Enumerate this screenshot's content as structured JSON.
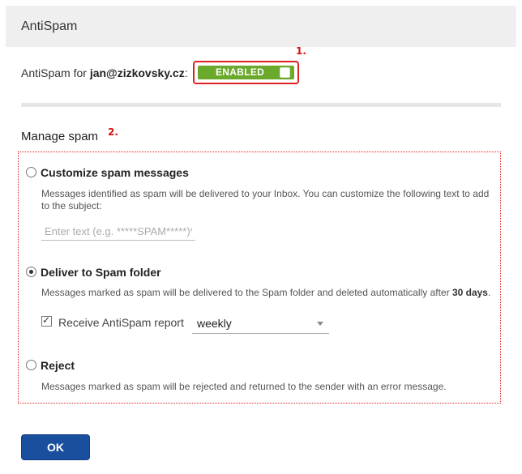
{
  "header": {
    "title": "AntiSpam"
  },
  "status": {
    "prefix": "AntiSpam for",
    "email": "jan@zizkovsky.cz",
    "suffix": ":",
    "toggle_label": "ENABLED",
    "toggle_color": "#6aa92b"
  },
  "annotations": {
    "one": "1.",
    "two": "2."
  },
  "manage": {
    "title": "Manage spam",
    "options": [
      {
        "title": "Customize spam messages",
        "description": "Messages identified as spam will be delivered to your Inbox. You can customize the following text to add to the subject:",
        "input_placeholder": "Enter text (e.g. *****SPAM*****)*",
        "selected": false
      },
      {
        "title": "Deliver to Spam folder",
        "description_prefix": "Messages marked as spam will be delivered to the Spam folder and deleted automatically after ",
        "description_bold": "30 days",
        "description_suffix": ".",
        "report_label": "Receive AntiSpam report",
        "report_checked": true,
        "report_frequency": "weekly",
        "selected": true
      },
      {
        "title": "Reject",
        "description": "Messages marked as spam will be rejected and returned to the sender with an error message.",
        "selected": false
      }
    ]
  },
  "footer": {
    "ok_label": "OK",
    "ok_color": "#1a4f9e"
  },
  "colors": {
    "annotation": "#d81010",
    "header_bg": "#efefef"
  }
}
